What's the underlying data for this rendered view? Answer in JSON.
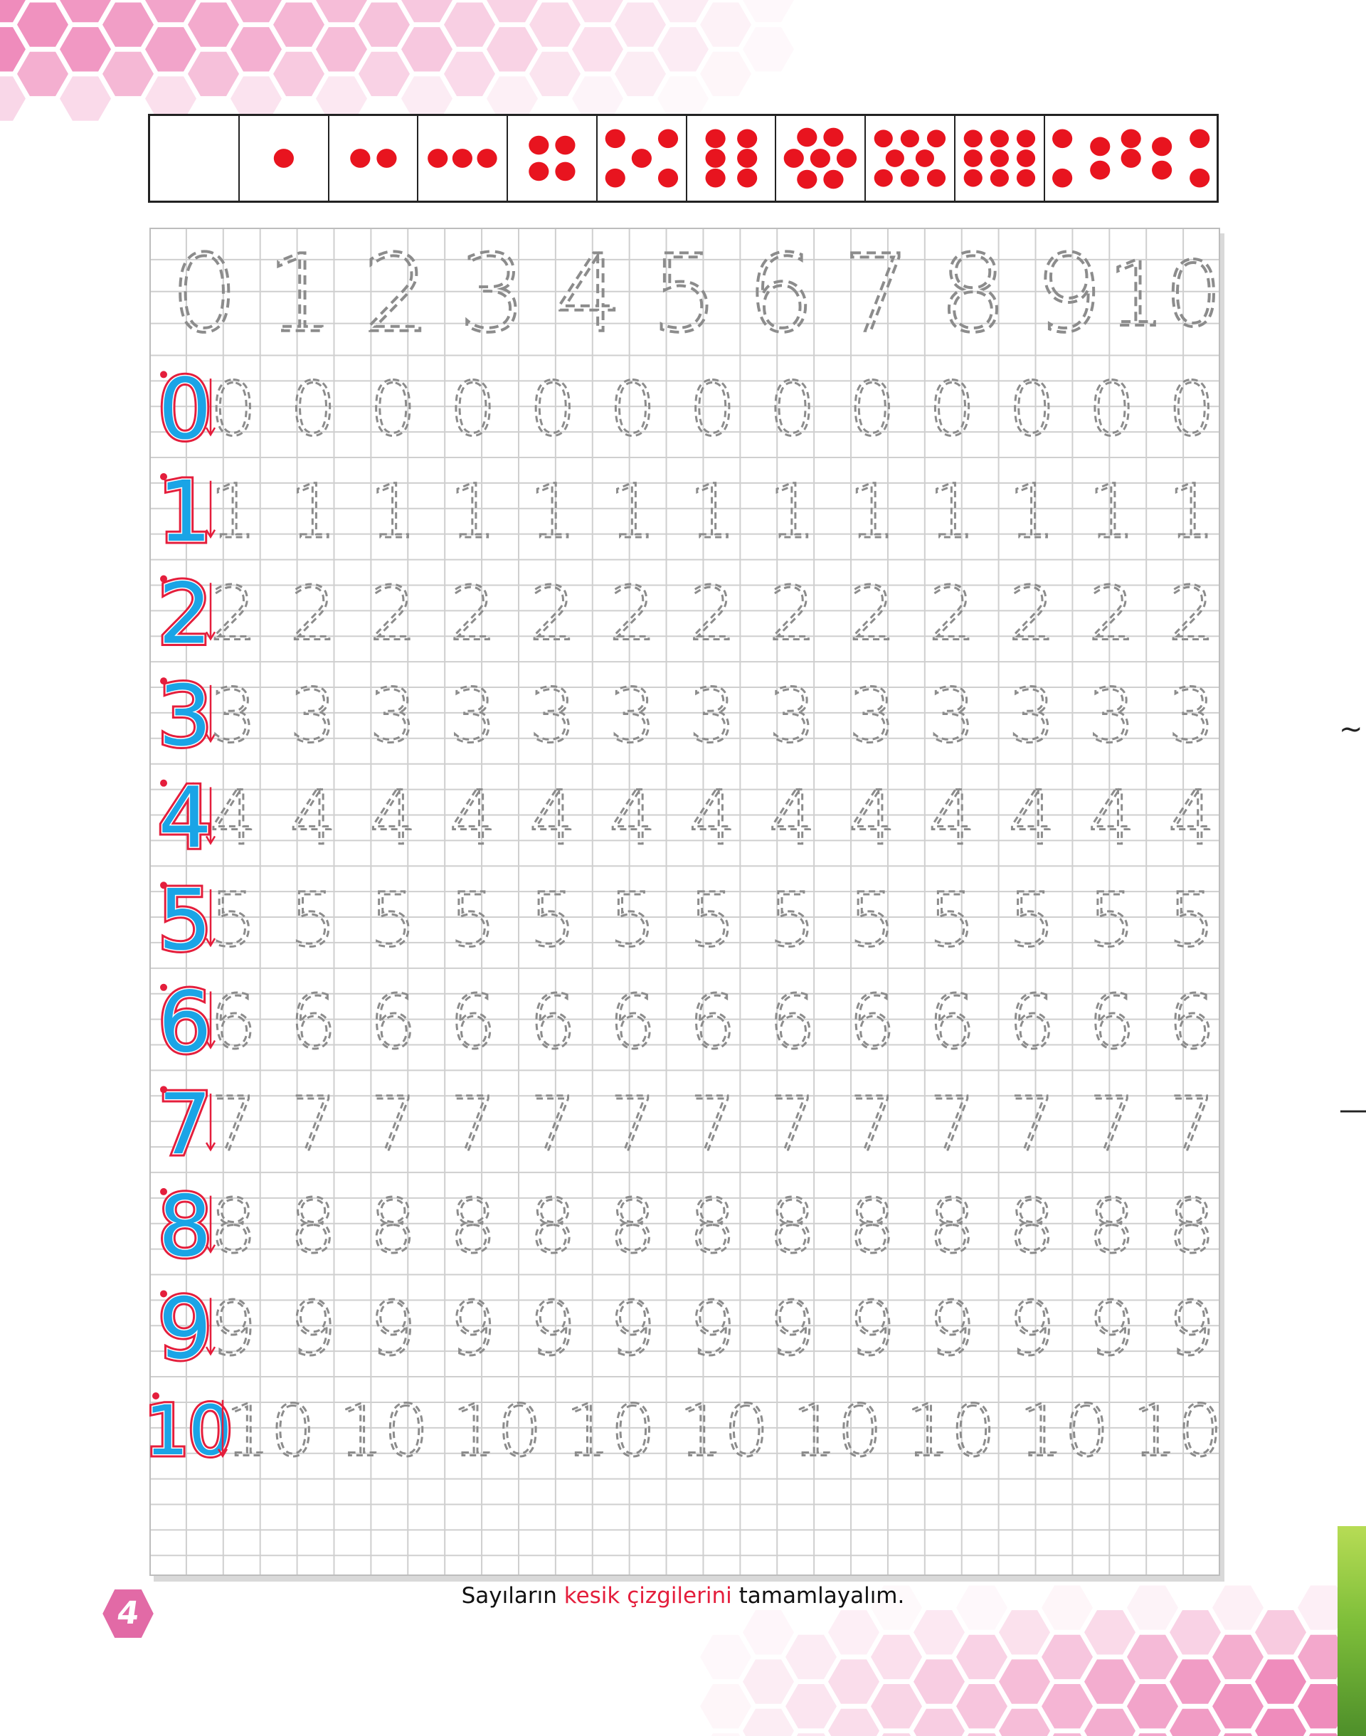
{
  "instruction": {
    "part1": "Sayıların ",
    "highlight": "kesik çizgilerini",
    "part2": " tamamlayalım."
  },
  "page_number": "4",
  "dot_cards": [
    0,
    1,
    2,
    3,
    4,
    5,
    6,
    7,
    8,
    9,
    10
  ],
  "header_digits": [
    "0",
    "1",
    "2",
    "3",
    "4",
    "5",
    "6",
    "7",
    "8",
    "9",
    "10"
  ],
  "practice_rows": [
    {
      "model": "0",
      "traces": 13
    },
    {
      "model": "1",
      "traces": 13
    },
    {
      "model": "2",
      "traces": 13
    },
    {
      "model": "3",
      "traces": 13
    },
    {
      "model": "4",
      "traces": 13
    },
    {
      "model": "5",
      "traces": 13
    },
    {
      "model": "6",
      "traces": 13
    },
    {
      "model": "7",
      "traces": 13
    },
    {
      "model": "8",
      "traces": 13
    },
    {
      "model": "9",
      "traces": 13
    },
    {
      "model": "10",
      "traces": 9
    }
  ],
  "edge_marks": [
    "~",
    "—"
  ],
  "colors": {
    "dot_red": "#e8141f",
    "model_blue": "#1aa4e6",
    "model_outline": "#e41e3c",
    "trace_gray": "#8c8c8c",
    "grid_gray": "#cfcfcf",
    "hex_pink": "#ee86b8",
    "highlight_red": "#e41e3c",
    "badge_pink": "#e26aa6"
  }
}
